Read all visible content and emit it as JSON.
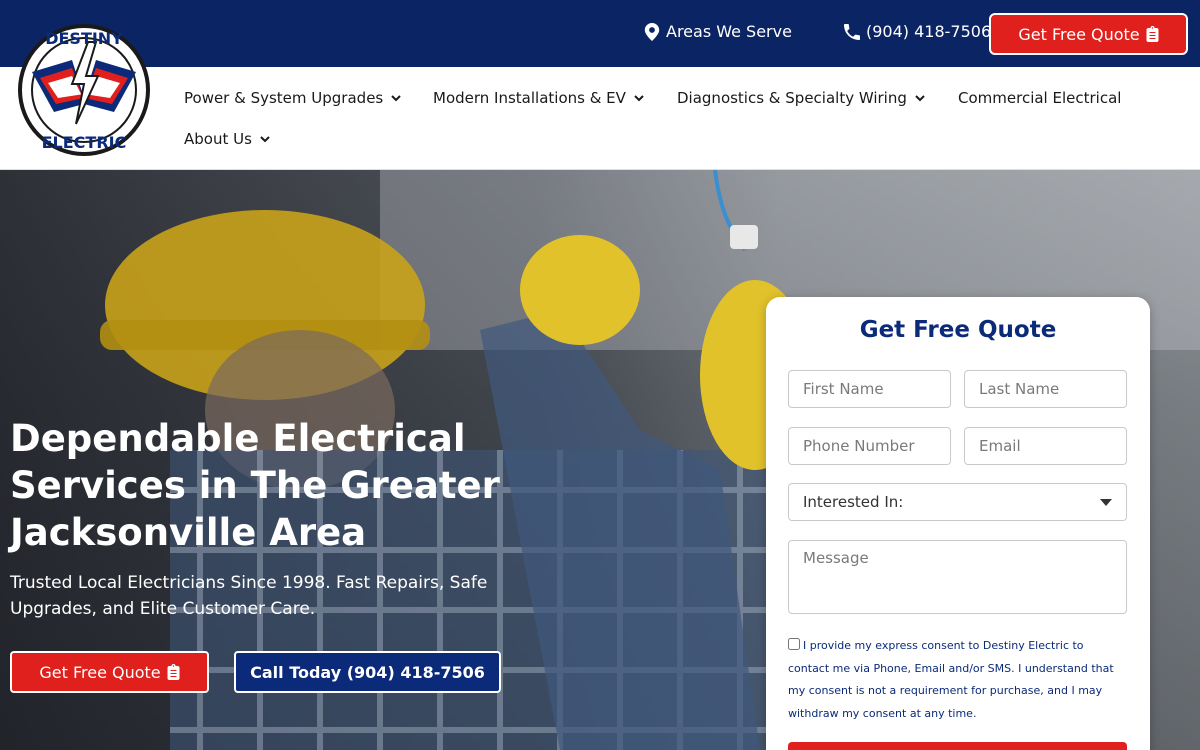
{
  "topbar": {
    "areas_label": "Areas We Serve",
    "phone_label": "(904) 418-7506",
    "cta_label": "Get Free Quote"
  },
  "logo": {
    "top_text": "DESTINY",
    "bottom_text": "ELECTRIC"
  },
  "nav": {
    "items": [
      {
        "label": "Power & System Upgrades"
      },
      {
        "label": "Modern Installations & EV"
      },
      {
        "label": "Diagnostics & Specialty Wiring"
      },
      {
        "label": "Commercial Electrical"
      },
      {
        "label": "About Us"
      }
    ]
  },
  "hero": {
    "title": "Dependable Electrical Services in The Greater Jacksonville Area",
    "subtitle": "Trusted Local Electricians Since 1998. Fast Repairs, Safe Upgrades, and Elite Customer Care.",
    "primary_cta": "Get Free Quote",
    "secondary_cta": "Call Today (904) 418-7506"
  },
  "form": {
    "title": "Get Free Quote",
    "first_name_placeholder": "First Name",
    "last_name_placeholder": "Last Name",
    "phone_placeholder": "Phone Number",
    "email_placeholder": "Email",
    "interest_selected": "Interested In:",
    "message_placeholder": "Message",
    "consent_text": "I provide my express consent to Destiny Electric to contact me via Phone, Email and/or SMS. I understand that my consent is not a requirement for purchase, and I may withdraw my consent at any time."
  },
  "colors": {
    "navy": "#0b2463",
    "brand_blue": "#0b2a7a",
    "brand_red": "#e0201c"
  }
}
